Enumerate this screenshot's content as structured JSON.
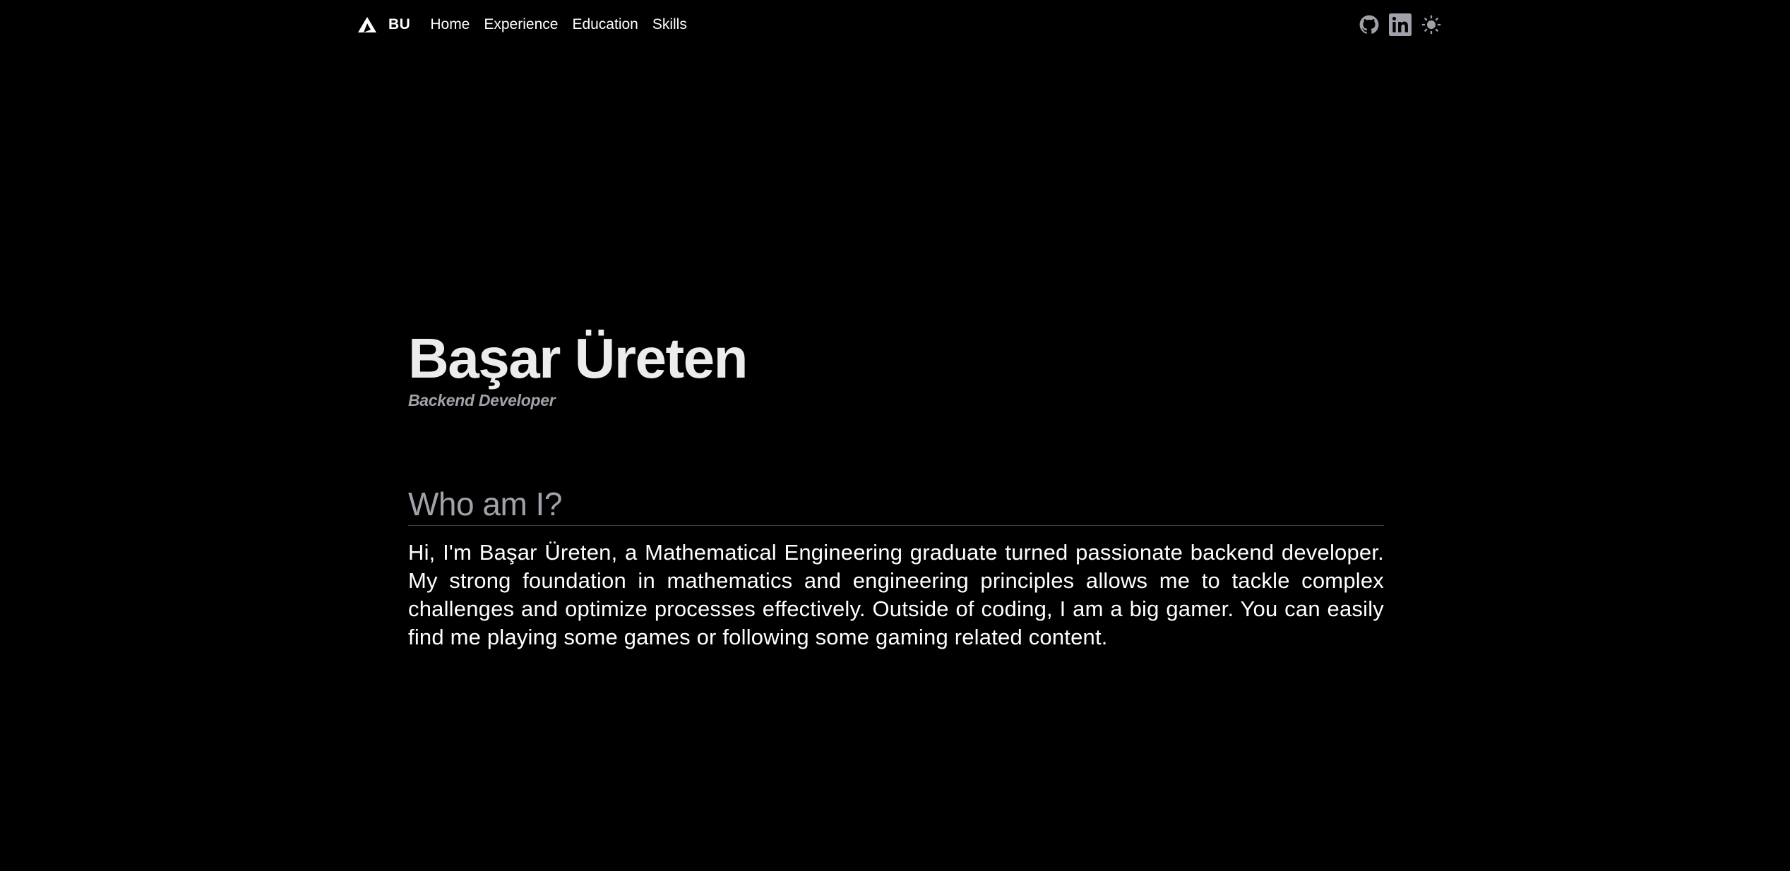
{
  "header": {
    "brand": "BU",
    "nav": [
      {
        "label": "Home"
      },
      {
        "label": "Experience"
      },
      {
        "label": "Education"
      },
      {
        "label": "Skills"
      }
    ],
    "icons": {
      "github": "github-icon",
      "linkedin": "linkedin-icon",
      "theme": "sun-icon"
    }
  },
  "hero": {
    "name": "Başar Üreten",
    "role": "Backend Developer"
  },
  "about": {
    "heading": "Who am I?",
    "text": "Hi, I'm Başar Üreten, a Mathematical Engineering graduate turned passionate backend developer. My strong foundation in mathematics and engineering principles allows me to tackle complex challenges and optimize processes effectively. Outside of coding, I am a big gamer. You can easily find me playing some games or following some gaming related content."
  },
  "colors": {
    "background": "#000000",
    "text": "#ededed",
    "muted": "#a1a1aa"
  }
}
